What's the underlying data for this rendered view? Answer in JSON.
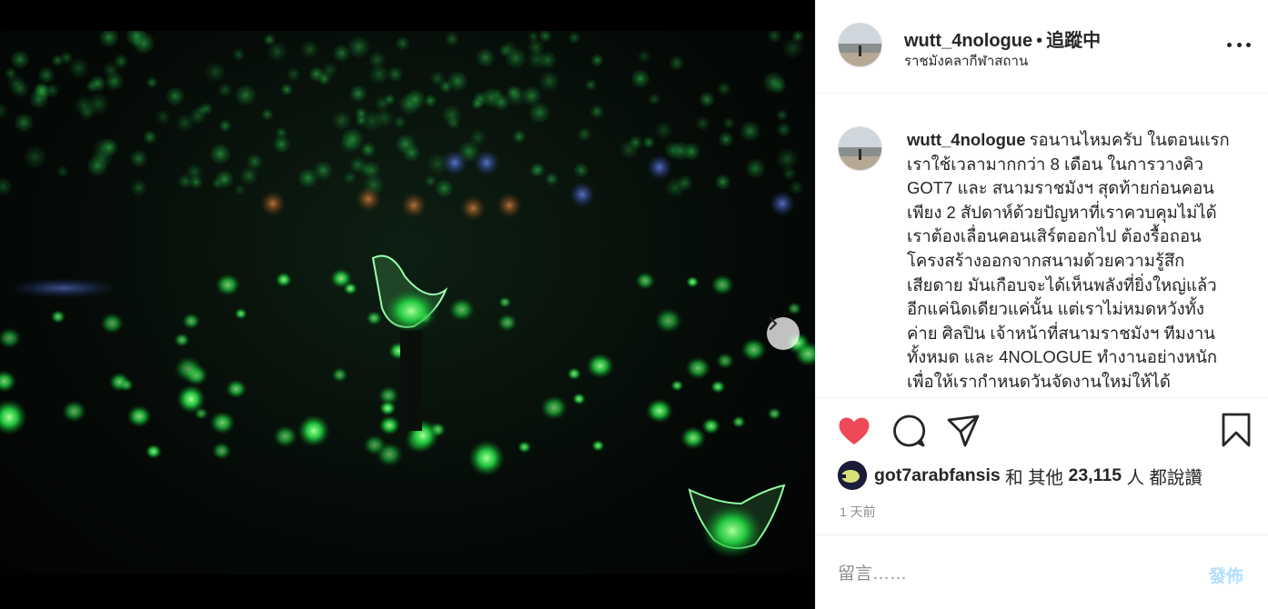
{
  "post": {
    "author": "wutt_4nologue",
    "separator": "•",
    "follow_state": "追蹤中",
    "location": "ราชมังคลากีฬาสถาน",
    "caption": "รอนานไหมครับ ในตอนแรกเราใช้เวลามากกว่า 8 เดือน ในการวางคิว GOT7 และ สนามราชมังฯ สุดท้ายก่อนคอนเพียง 2 สัปดาห์ด้วยปัญหาที่เราควบคุมไม่ได้ เราต้องเลื่อนคอนเสิร์ตออกไป ต้องรื้อถอนโครงสร้างออกจากสนามด้วยความรู้สึกเสียดาย มันเกือบจะได้เห็นพลังที่ยิ่งใหญ่แล้ว อีกแค่นิดเดียวแค่นั้น แต่เราไม่หมดหวังทั้งค่าย ศิลปิน เจ้าหน้าที่สนามราชมังฯ ทีมงานทั้งหมด และ 4NOLOGUE ทำงานอย่างหนักเพื่อให้เรากำหนดวันจัดงานใหม่ให้ได้",
    "liked_by": "got7arabfansis",
    "likes_mid": "和 其他",
    "likes_count": "23,115",
    "likes_suffix": "人 都說讚",
    "time_ago": "1 天前"
  },
  "comment_box": {
    "placeholder": "留言……",
    "post_label": "發佈"
  },
  "carousel": {
    "total": 8,
    "active_index": 0
  },
  "colors": {
    "heart": "#ed4956",
    "link_disabled": "#b2dffc",
    "glow_green": "#39ff5a"
  },
  "icons": {
    "like": "heart-icon",
    "comment": "comment-icon",
    "share": "share-icon",
    "save": "bookmark-icon",
    "more": "more-options-icon",
    "next": "chevron-right-icon"
  }
}
